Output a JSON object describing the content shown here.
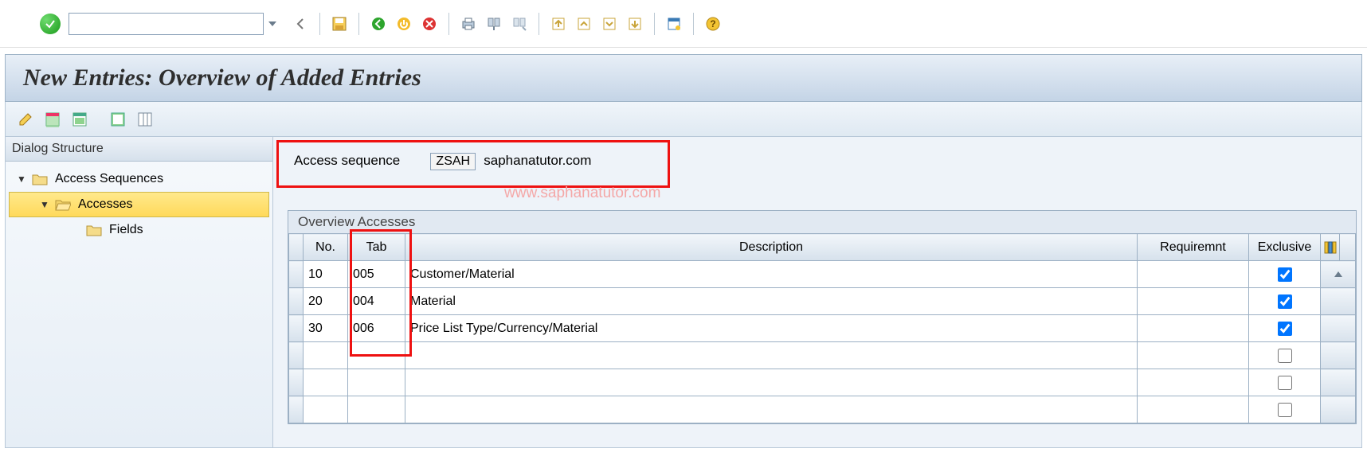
{
  "title": "New Entries: Overview of Added Entries",
  "dialog_structure": {
    "title": "Dialog Structure",
    "nodes": {
      "access_sequences": "Access Sequences",
      "accesses": "Accesses",
      "fields": "Fields"
    }
  },
  "header": {
    "label": "Access sequence",
    "code": "ZSAH",
    "desc": "saphanatutor.com"
  },
  "watermark": "www.saphanatutor.com",
  "table": {
    "caption": "Overview Accesses",
    "columns": {
      "no": "No.",
      "tab": "Tab",
      "desc": "Description",
      "req": "Requiremnt",
      "exc": "Exclusive"
    },
    "rows": [
      {
        "no": "10",
        "tab": "005",
        "desc": "Customer/Material",
        "req": "",
        "exc": true
      },
      {
        "no": "20",
        "tab": "004",
        "desc": "Material",
        "req": "",
        "exc": true
      },
      {
        "no": "30",
        "tab": "006",
        "desc": "Price List Type/Currency/Material",
        "req": "",
        "exc": true
      },
      {
        "no": "",
        "tab": "",
        "desc": "",
        "req": "",
        "exc": false
      },
      {
        "no": "",
        "tab": "",
        "desc": "",
        "req": "",
        "exc": false
      },
      {
        "no": "",
        "tab": "",
        "desc": "",
        "req": "",
        "exc": false
      }
    ]
  }
}
